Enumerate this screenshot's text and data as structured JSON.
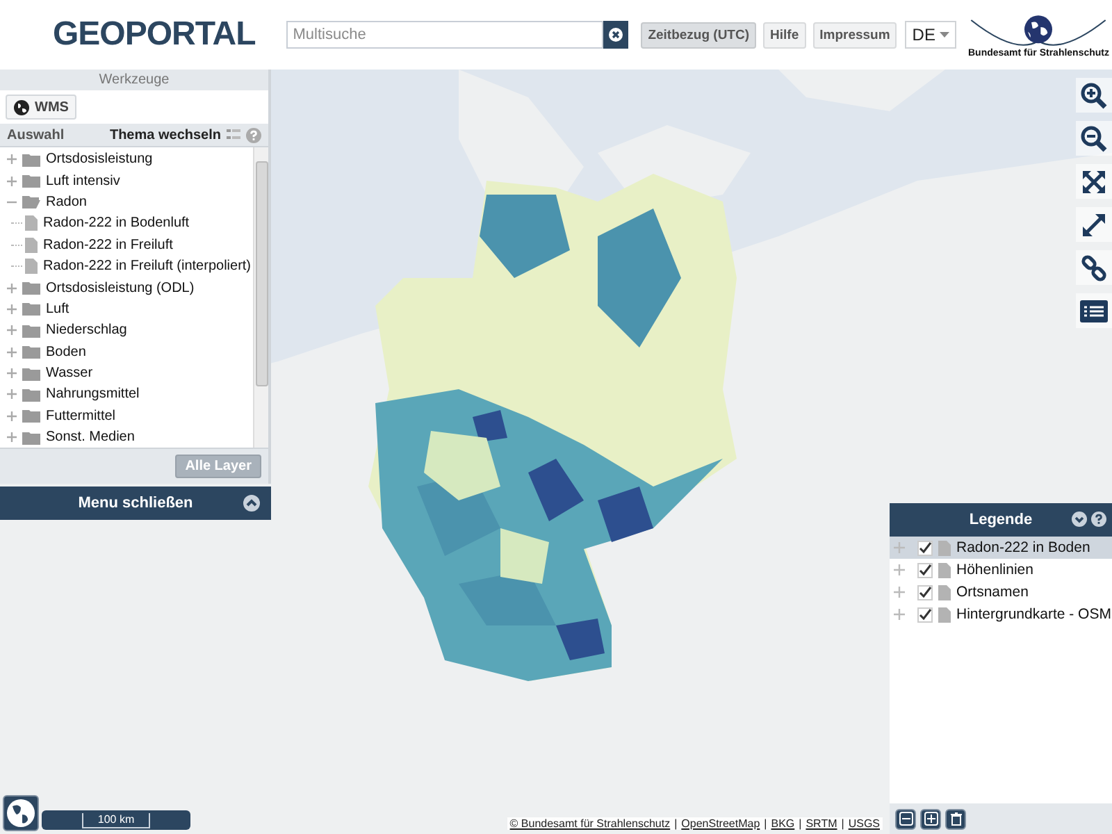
{
  "header": {
    "logo": "GEOPORTAL",
    "search": {
      "placeholder": "Multisuche"
    },
    "buttons": [
      {
        "label": "Zeitbezug (UTC)",
        "selected": true
      },
      {
        "label": "Hilfe",
        "selected": false
      },
      {
        "label": "Impressum",
        "selected": false
      }
    ],
    "language": "DE",
    "agency": "Bundesamt für Strahlenschutz"
  },
  "left_panel": {
    "title": "Werkzeuge",
    "tool_button": "WMS",
    "selection_label": "Auswahl",
    "theme_switch": "Thema wechseln",
    "tree": [
      {
        "label": "Ortsdosisleistung",
        "kind": "folder",
        "expanded": false
      },
      {
        "label": "Luft intensiv",
        "kind": "folder",
        "expanded": false
      },
      {
        "label": "Radon",
        "kind": "folder",
        "expanded": true,
        "children": [
          {
            "label": "Radon-222 in Bodenluft",
            "kind": "layer"
          },
          {
            "label": "Radon-222 in Freiluft",
            "kind": "layer"
          },
          {
            "label": "Radon-222 in Freiluft (interpoliert)",
            "kind": "layer"
          }
        ]
      },
      {
        "label": "Ortsdosisleistung (ODL)",
        "kind": "folder",
        "expanded": false
      },
      {
        "label": "Luft",
        "kind": "folder",
        "expanded": false
      },
      {
        "label": "Niederschlag",
        "kind": "folder",
        "expanded": false
      },
      {
        "label": "Boden",
        "kind": "folder",
        "expanded": false
      },
      {
        "label": "Wasser",
        "kind": "folder",
        "expanded": false
      },
      {
        "label": "Nahrungsmittel",
        "kind": "folder",
        "expanded": false
      },
      {
        "label": "Futtermittel",
        "kind": "folder",
        "expanded": false
      },
      {
        "label": "Sonst. Medien",
        "kind": "folder",
        "expanded": false
      }
    ],
    "all_layers_button": "Alle Layer",
    "menu_bar": "Menu schließen"
  },
  "legend": {
    "title": "Legende",
    "items": [
      {
        "label": "Radon-222 in Boden",
        "checked": true,
        "selected": true
      },
      {
        "label": "Höhenlinien",
        "checked": true,
        "selected": false
      },
      {
        "label": "Ortsnamen",
        "checked": true,
        "selected": false
      },
      {
        "label": "Hintergrundkarte - OSM",
        "checked": true,
        "selected": false
      }
    ]
  },
  "scale": "100 km",
  "attribution": {
    "links": [
      "© Bundesamt für Strahlenschutz",
      "OpenStreetMap",
      "BKG",
      "SRTM",
      "USGS"
    ],
    "separator": "|"
  }
}
